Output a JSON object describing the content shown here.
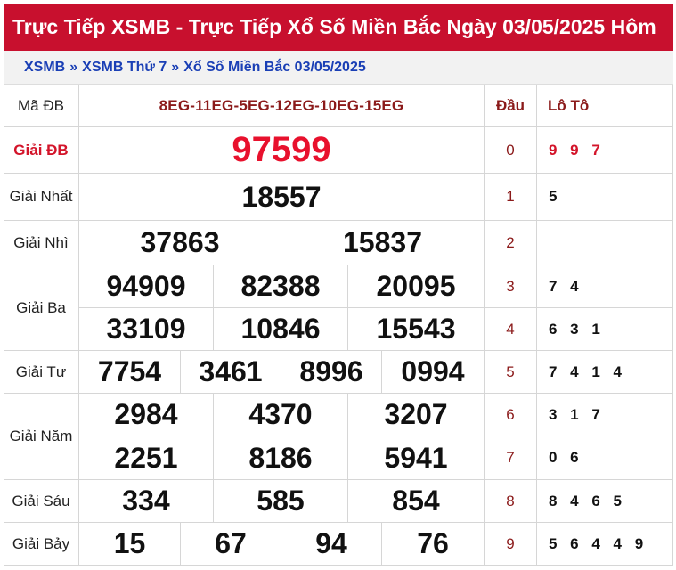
{
  "header": {
    "title": "Trực Tiếp XSMB - Trực Tiếp Xổ Số Miền Bắc Ngày 03/05/2025 Hôm"
  },
  "breadcrumb": [
    "XSMB",
    "XSMB Thứ 7",
    "Xổ Số Miền Bắc 03/05/2025"
  ],
  "breadcrumb_sep": "»",
  "results": {
    "ma_db_label": "Mã ĐB",
    "ma_db": "8EG-11EG-5EG-12EG-10EG-15EG",
    "prizes": [
      {
        "label": "Giải ĐB",
        "numbers": [
          "97599"
        ]
      },
      {
        "label": "Giải Nhất",
        "numbers": [
          "18557"
        ]
      },
      {
        "label": "Giải Nhì",
        "numbers": [
          "37863",
          "15837"
        ]
      },
      {
        "label": "Giải Ba",
        "numbers": [
          "94909",
          "82388",
          "20095",
          "33109",
          "10846",
          "15543"
        ]
      },
      {
        "label": "Giải Tư",
        "numbers": [
          "7754",
          "3461",
          "8996",
          "0994"
        ]
      },
      {
        "label": "Giải Năm",
        "numbers": [
          "2984",
          "4370",
          "3207",
          "2251",
          "8186",
          "5941"
        ]
      },
      {
        "label": "Giải Sáu",
        "numbers": [
          "334",
          "585",
          "854"
        ]
      },
      {
        "label": "Giải Bảy",
        "numbers": [
          "15",
          "67",
          "94",
          "76"
        ]
      }
    ]
  },
  "loto": {
    "dau_header": "Đầu",
    "loto_header": "Lô Tô",
    "rows": [
      {
        "dau": "0",
        "values": "9 9 7"
      },
      {
        "dau": "1",
        "values": "5"
      },
      {
        "dau": "2",
        "values": ""
      },
      {
        "dau": "3",
        "values": "7 4"
      },
      {
        "dau": "4",
        "values": "6 3 1"
      },
      {
        "dau": "5",
        "values": "7 4 1 4"
      },
      {
        "dau": "6",
        "values": "3 1 7"
      },
      {
        "dau": "7",
        "values": "0 6"
      },
      {
        "dau": "8",
        "values": "8 4 6 5"
      },
      {
        "dau": "9",
        "values": "5 6 4 4 9"
      }
    ]
  },
  "colors": {
    "header_bg": "#c8102e",
    "special_prize": "#e8112d",
    "link": "#1a3fb5"
  }
}
